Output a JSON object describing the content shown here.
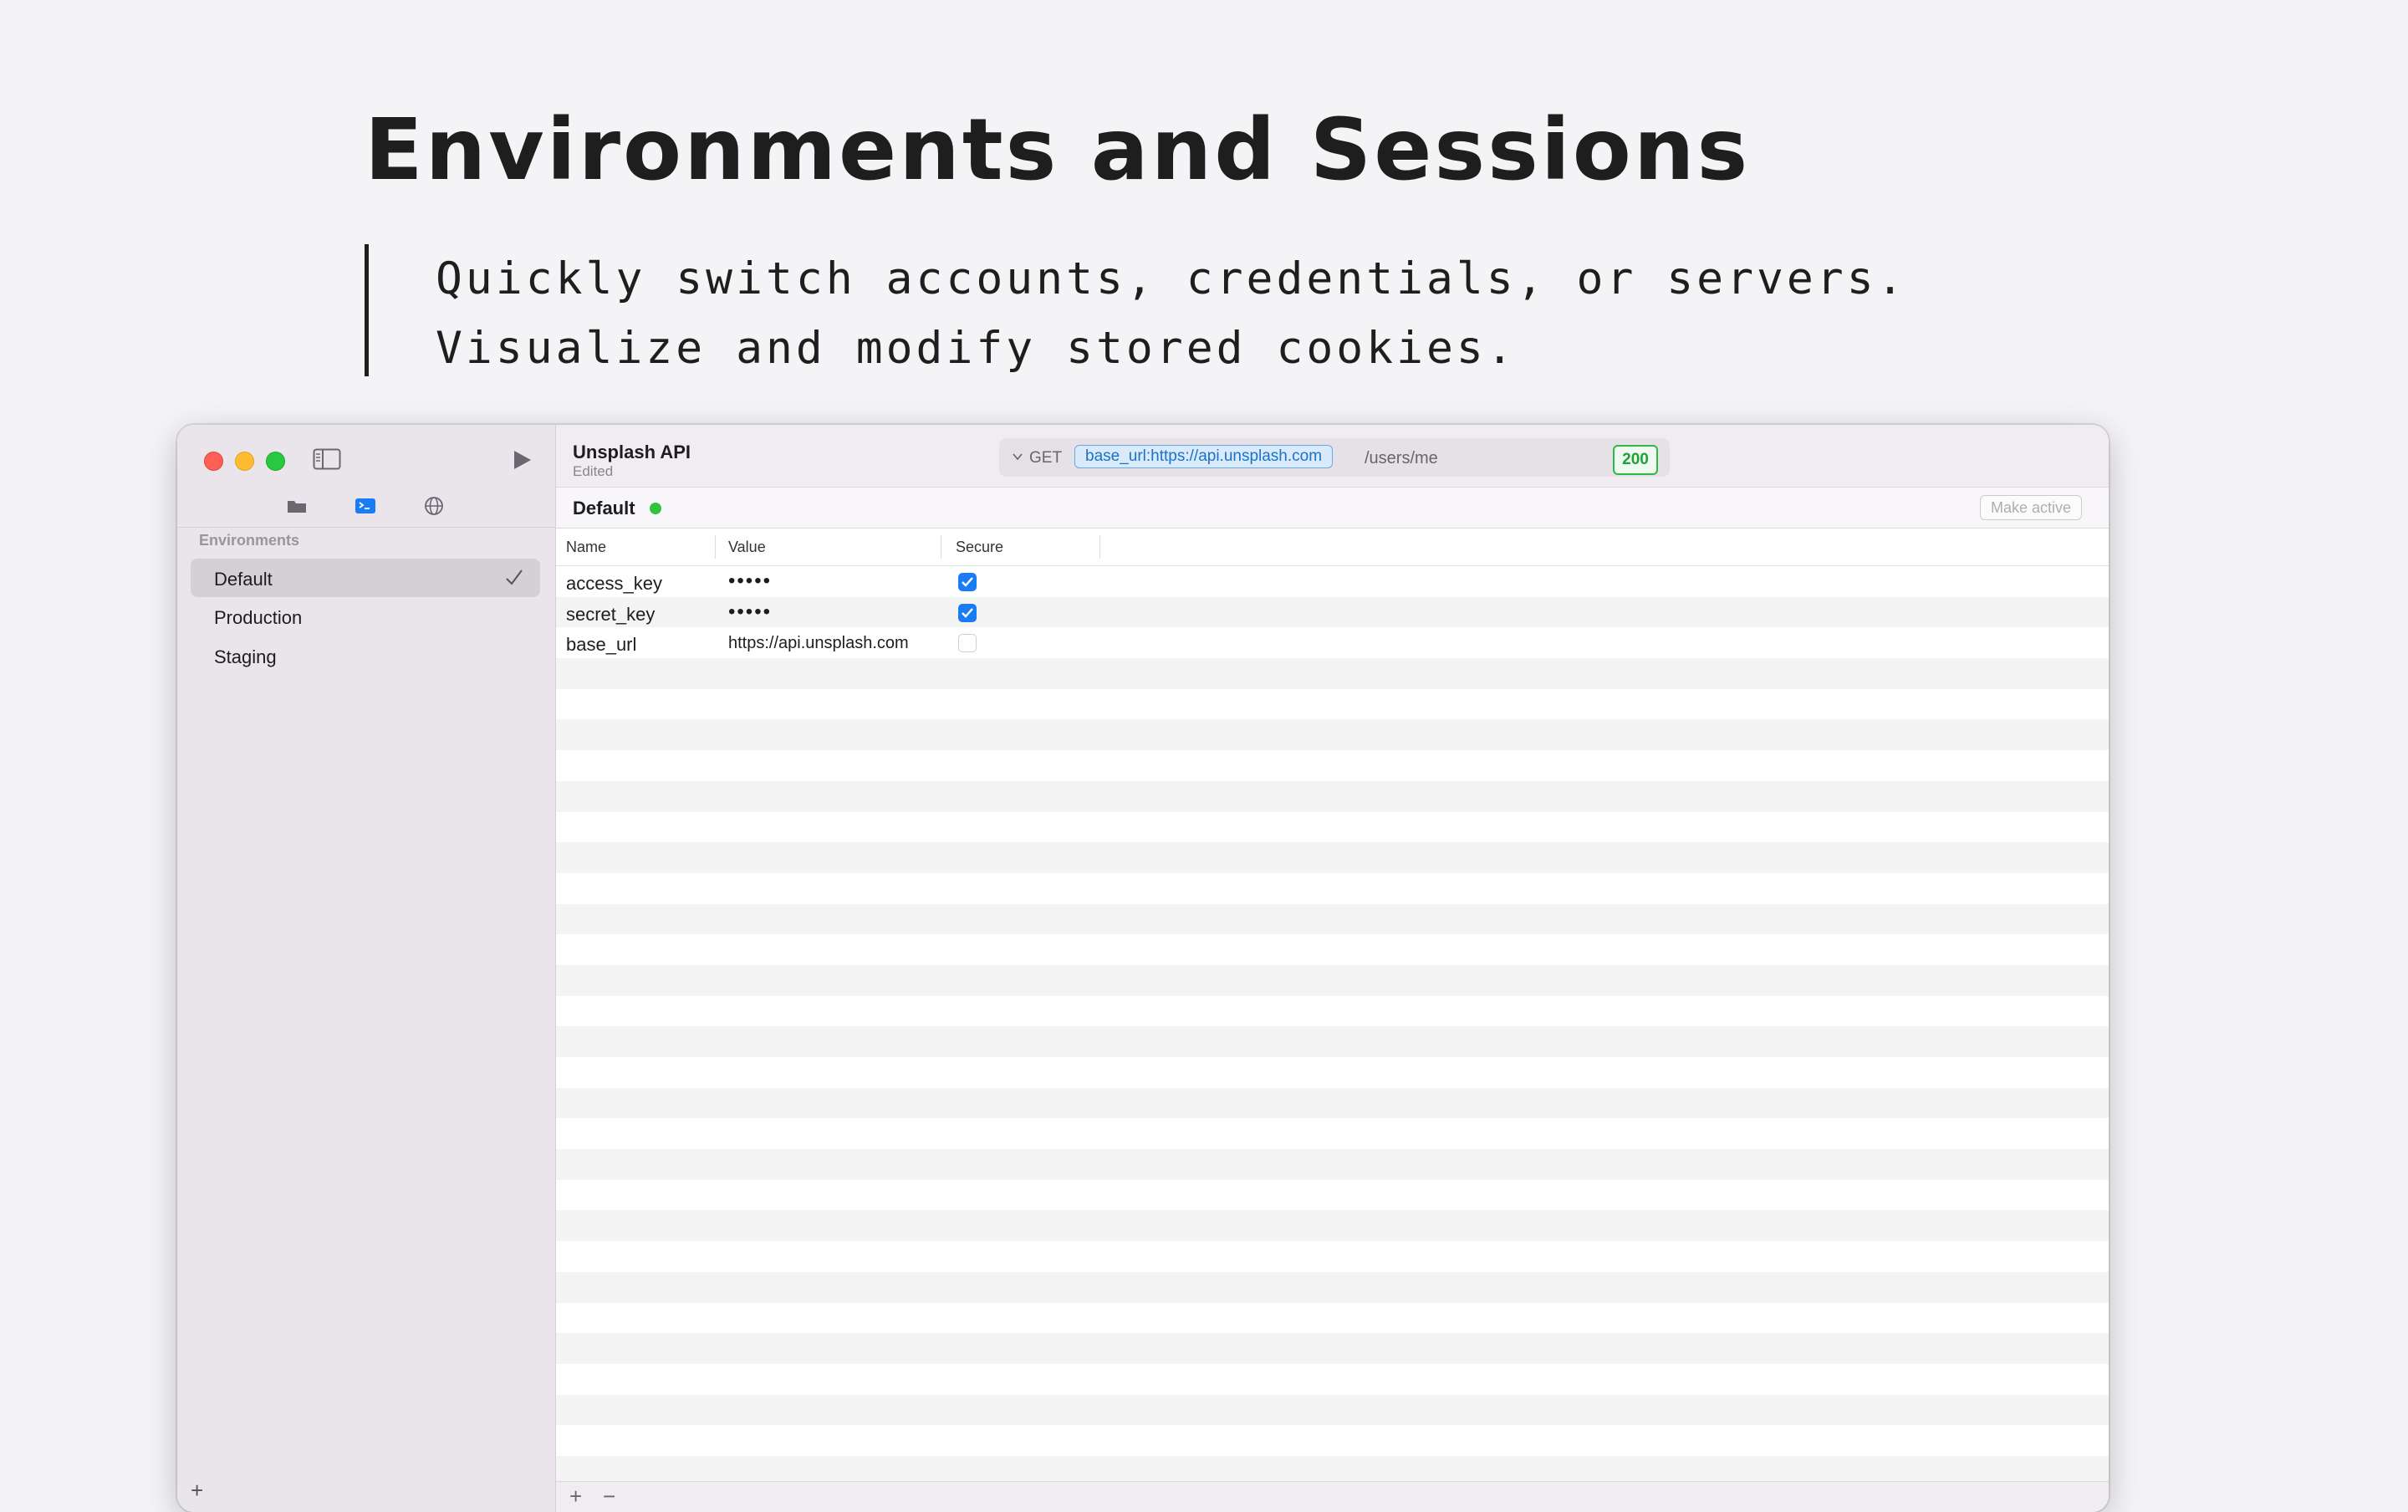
{
  "hero": {
    "title": "Environments and Sessions",
    "line1": "Quickly switch accounts, credentials, or servers.",
    "line2": "Visualize and modify stored cookies."
  },
  "window": {
    "doc_title": "Unsplash API",
    "doc_status": "Edited",
    "request": {
      "method": "GET",
      "token": "base_url:https://api.unsplash.com",
      "path": "/users/me",
      "status": "200"
    },
    "sidebar": {
      "section": "Environments",
      "items": [
        {
          "label": "Default",
          "active": true
        },
        {
          "label": "Production"
        },
        {
          "label": "Staging"
        }
      ],
      "add_label": "+"
    },
    "env_header": {
      "name": "Default",
      "make_active": "Make active"
    },
    "table": {
      "columns": [
        "Name",
        "Value",
        "Secure"
      ],
      "rows": [
        {
          "name": "access_key",
          "value": "•••••",
          "secure": true
        },
        {
          "name": "secret_key",
          "value": "•••••",
          "secure": true
        },
        {
          "name": "base_url",
          "value": "https://api.unsplash.com",
          "secure": false
        }
      ]
    },
    "footer": {
      "add": "+",
      "remove": "−"
    }
  },
  "colors": {
    "accent": "#1a7cf5",
    "status_ok": "#2fb846",
    "active_dot": "#2bc43b"
  }
}
